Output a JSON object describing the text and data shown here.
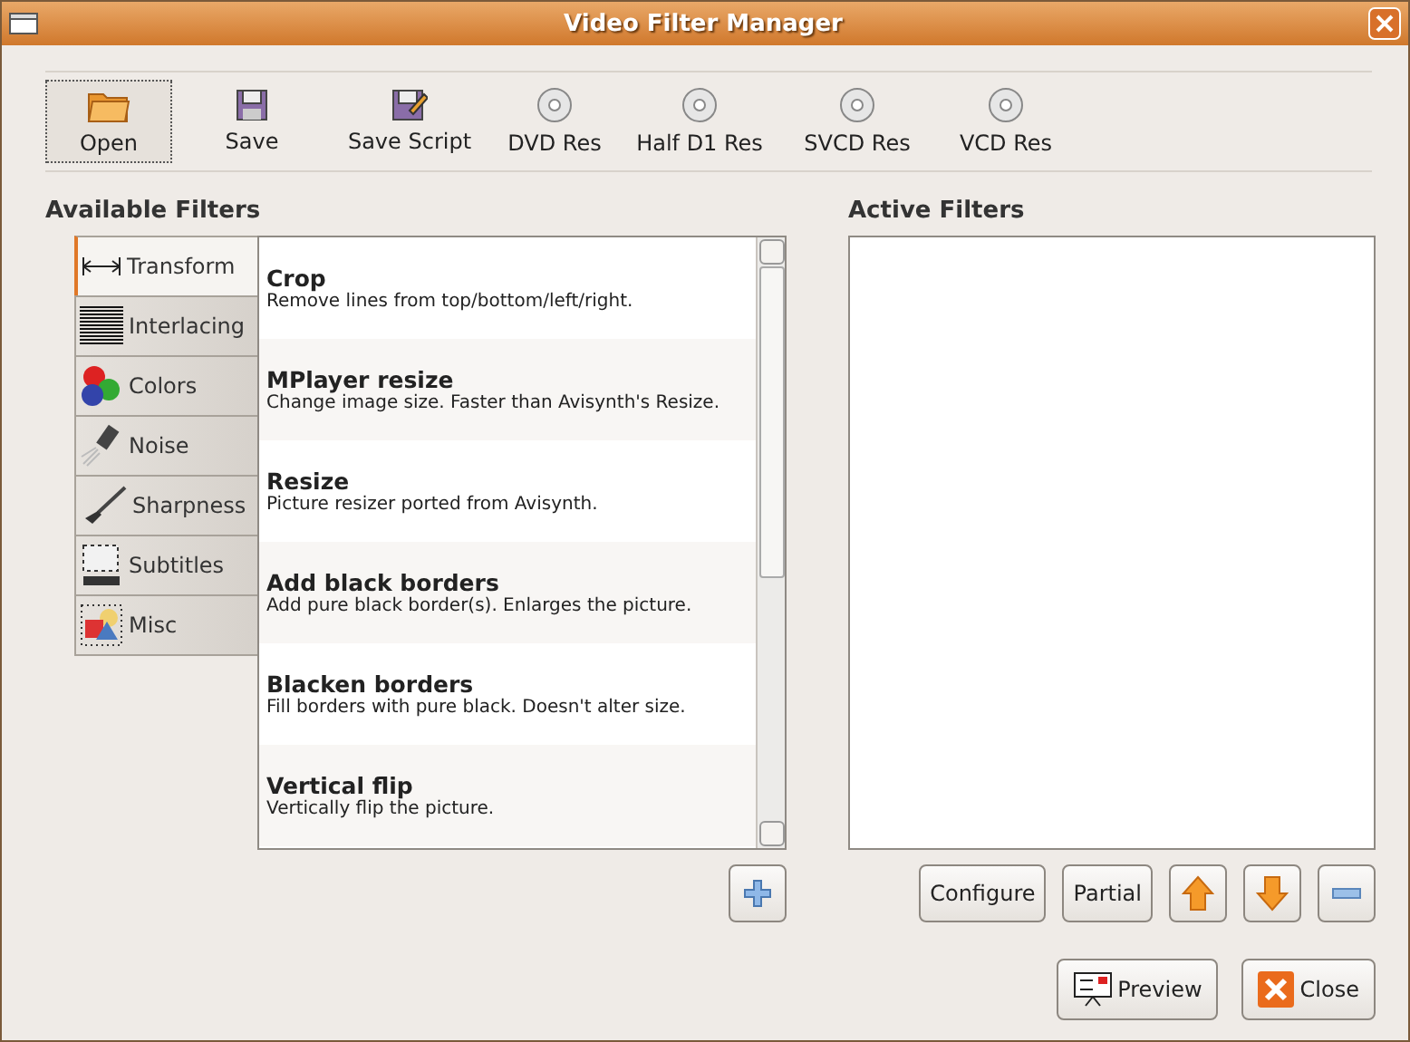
{
  "window": {
    "title": "Video Filter Manager"
  },
  "toolbar": [
    {
      "label": "Open",
      "kind": "folder",
      "focused": true
    },
    {
      "label": "Save",
      "kind": "disk",
      "focused": false
    },
    {
      "label": "Save Script",
      "kind": "script",
      "focused": false
    },
    {
      "label": "DVD Res",
      "kind": "disc",
      "focused": false
    },
    {
      "label": "Half D1 Res",
      "kind": "disc",
      "focused": false
    },
    {
      "label": "SVCD Res",
      "kind": "disc",
      "focused": false
    },
    {
      "label": "VCD Res",
      "kind": "disc",
      "focused": false
    }
  ],
  "available_filters": {
    "heading": "Available Filters",
    "categories": [
      {
        "label": "Transform",
        "kind": "transform",
        "selected": true
      },
      {
        "label": "Interlacing",
        "kind": "lines",
        "selected": false
      },
      {
        "label": "Colors",
        "kind": "colors",
        "selected": false
      },
      {
        "label": "Noise",
        "kind": "noise",
        "selected": false
      },
      {
        "label": "Sharpness",
        "kind": "brush",
        "selected": false
      },
      {
        "label": "Subtitles",
        "kind": "subtitles",
        "selected": false
      },
      {
        "label": "Misc",
        "kind": "shapes",
        "selected": false
      }
    ],
    "filters": [
      {
        "title": "Crop",
        "description": "Remove lines from top/bottom/left/right."
      },
      {
        "title": "MPlayer resize",
        "description": "Change image size. Faster than Avisynth's Resize."
      },
      {
        "title": "Resize",
        "description": "Picture resizer ported from Avisynth."
      },
      {
        "title": "Add black borders",
        "description": "Add pure black border(s). Enlarges the picture."
      },
      {
        "title": "Blacken borders",
        "description": "Fill borders with pure black. Doesn't alter size."
      },
      {
        "title": "Vertical flip",
        "description": "Vertically flip the picture."
      }
    ]
  },
  "active_filters": {
    "heading": "Active Filters",
    "buttons": [
      {
        "kind": "text",
        "label": "Configure"
      },
      {
        "kind": "text",
        "label": "Partial"
      },
      {
        "kind": "up"
      },
      {
        "kind": "down"
      },
      {
        "kind": "remove"
      }
    ]
  },
  "dialog_buttons": [
    {
      "label": "Preview",
      "kind": "preview"
    },
    {
      "label": "Close",
      "kind": "close"
    }
  ]
}
